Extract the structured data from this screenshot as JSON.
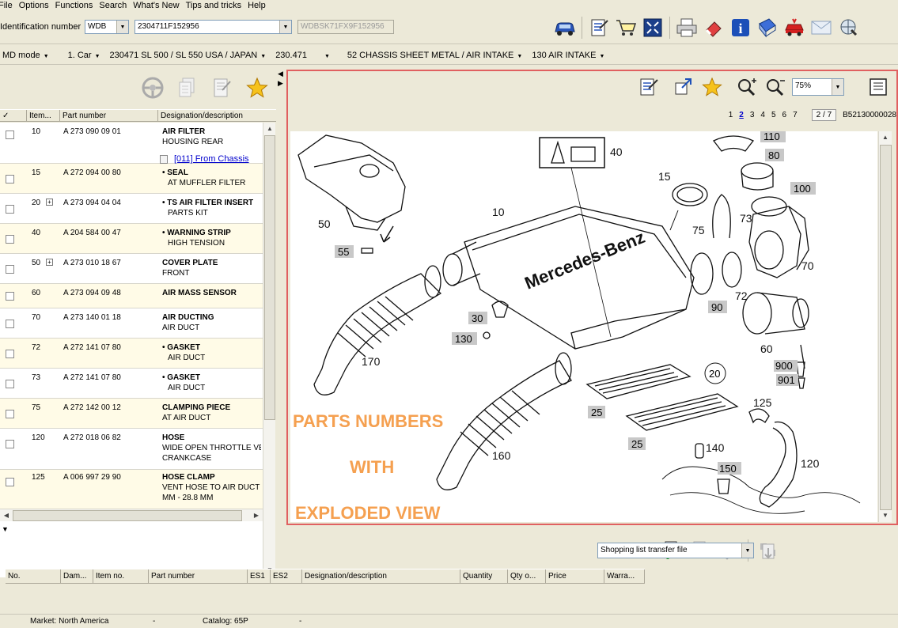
{
  "menu": [
    "File",
    "Options",
    "Functions",
    "Search",
    "What's New",
    "Tips and tricks",
    "Help"
  ],
  "id_bar": {
    "label": "Identification number",
    "prefix": "WDB",
    "number": "2304711F152956",
    "vin": "WDBSK71FX9F152956"
  },
  "breadcrumb": [
    "MD mode",
    "1. Car",
    "230471 SL 500 / SL 550 USA / JAPAN",
    "230.471",
    "52 CHASSIS SHEET METAL / AIR INTAKE",
    "130 AIR INTAKE"
  ],
  "parts_table": {
    "headers": [
      "✓",
      "Item...",
      "Part number",
      "Designation/description"
    ],
    "rows": [
      {
        "item": "10",
        "plus": false,
        "pn": "A 273 090 09 01",
        "d1": "AIR FILTER",
        "d2": "HOUSING REAR",
        "link": "[011] From Chassis"
      },
      {
        "item": "15",
        "plus": false,
        "pn": "A 272 094 00 80",
        "d1": "• SEAL",
        "d2": "AT MUFFLER FILTER"
      },
      {
        "item": "20",
        "plus": true,
        "pn": "A 273 094 04 04",
        "d1": "• TS AIR FILTER INSERT",
        "d2": "PARTS KIT"
      },
      {
        "item": "40",
        "plus": false,
        "pn": "A 204 584 00 47",
        "d1": "• WARNING STRIP",
        "d2": "HIGH TENSION"
      },
      {
        "item": "50",
        "plus": true,
        "pn": "A 273 010 18 67",
        "d1": "COVER PLATE",
        "d2": "FRONT"
      },
      {
        "item": "60",
        "plus": false,
        "pn": "A 273 094 09 48",
        "d1": "AIR MASS SENSOR",
        "d2": ""
      },
      {
        "item": "70",
        "plus": false,
        "pn": "A 273 140 01 18",
        "d1": "AIR DUCTING",
        "d2": "AIR DUCT"
      },
      {
        "item": "72",
        "plus": false,
        "pn": "A 272 141 07 80",
        "d1": "• GASKET",
        "d2": "AIR DUCT"
      },
      {
        "item": "73",
        "plus": false,
        "pn": "A 272 141 07 80",
        "d1": "• GASKET",
        "d2": "AIR DUCT"
      },
      {
        "item": "75",
        "plus": false,
        "pn": "A 272 142 00 12",
        "d1": "CLAMPING PIECE",
        "d2": "AT AIR DUCT"
      },
      {
        "item": "120",
        "plus": false,
        "pn": "A 272 018 06 82",
        "d1": "HOSE",
        "d2": "WIDE OPEN THROTTLE VENT",
        "d3": "CRANKCASE"
      },
      {
        "item": "125",
        "plus": false,
        "pn": "A 006 997 29 90",
        "d1": "HOSE CLAMP",
        "d2": "VENT HOSE TO AIR DUCT",
        "d3": "MM - 28.8 MM"
      }
    ]
  },
  "viewer": {
    "zoom": "75%",
    "pages": [
      "1",
      "2",
      "3",
      "4",
      "5",
      "6",
      "7"
    ],
    "current_page": "2",
    "page_count": "2 / 7",
    "doc_id": "B52130000028"
  },
  "diagram": {
    "overlay": [
      "PARTS NUMBERS",
      "WITH",
      "EXPLODED VIEW"
    ],
    "overlay_color": "#f5a050",
    "plain_labels": [
      "10",
      "15",
      "40",
      "50",
      "73",
      "75",
      "70",
      "72",
      "60",
      "170",
      "160",
      "125",
      "120",
      "140"
    ],
    "boxed_labels": [
      "110",
      "80",
      "100",
      "90",
      "55",
      "30",
      "130",
      "20",
      "25",
      "25",
      "900",
      "901",
      "150"
    ],
    "brand_text": "Mercedes-Benz"
  },
  "shopping": {
    "select": "Shopping list transfer file",
    "headers": [
      "No.",
      "Dam...",
      "Item no.",
      "Part number",
      "ES1",
      "ES2",
      "Designation/description",
      "Quantity",
      "Qty o...",
      "Price",
      "Warra..."
    ]
  },
  "status": {
    "market": "Market: North America",
    "sep1": "-",
    "catalog": "Catalog: 65P",
    "sep2": "-"
  }
}
